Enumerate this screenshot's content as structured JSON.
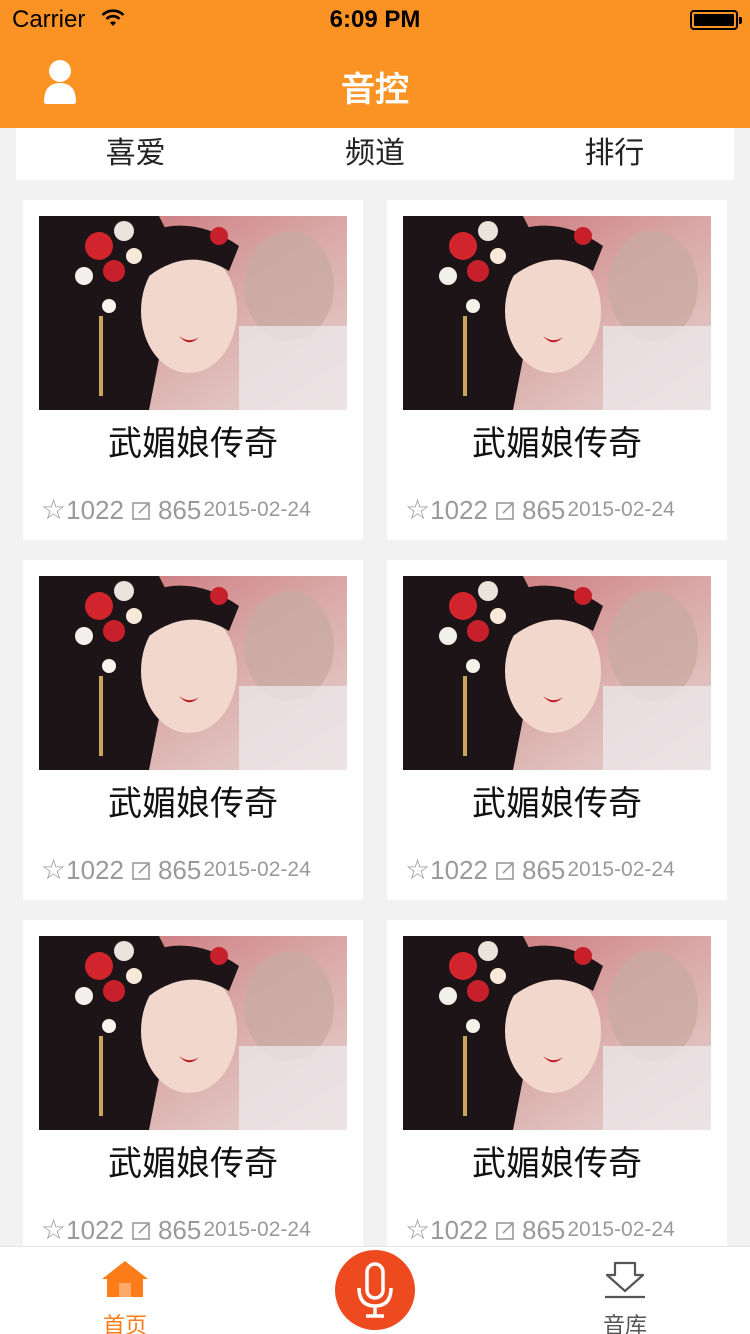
{
  "status": {
    "carrier": "Carrier",
    "time": "6:09 PM"
  },
  "nav": {
    "title": "音控",
    "user_icon": "user-icon"
  },
  "tabs": [
    {
      "label": "喜爱"
    },
    {
      "label": "频道"
    },
    {
      "label": "排行"
    }
  ],
  "cards": [
    {
      "title": "武媚娘传奇",
      "favorites": "1022",
      "comments": "865",
      "date": "2015-02-24"
    },
    {
      "title": "武媚娘传奇",
      "favorites": "1022",
      "comments": "865",
      "date": "2015-02-24"
    },
    {
      "title": "武媚娘传奇",
      "favorites": "1022",
      "comments": "865",
      "date": "2015-02-24"
    },
    {
      "title": "武媚娘传奇",
      "favorites": "1022",
      "comments": "865",
      "date": "2015-02-24"
    },
    {
      "title": "武媚娘传奇",
      "favorites": "1022",
      "comments": "865",
      "date": "2015-02-24"
    },
    {
      "title": "武媚娘传奇",
      "favorites": "1022",
      "comments": "865",
      "date": "2015-02-24"
    }
  ],
  "tabbar": {
    "home_label": "首页",
    "library_label": "音库",
    "icons": [
      "home-icon",
      "microphone-icon",
      "download-icon"
    ]
  },
  "colors": {
    "accent": "#fb9224",
    "active_tab": "#fb7c18",
    "mic_button": "#ee4a1f",
    "meta_text": "#9a9a9a"
  }
}
